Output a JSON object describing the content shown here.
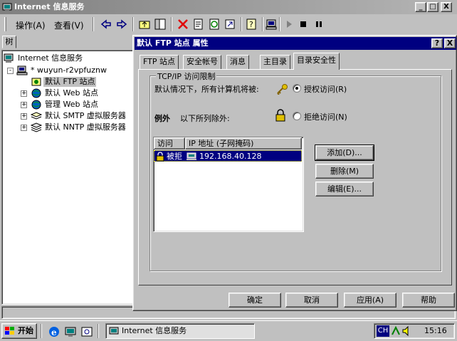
{
  "window": {
    "title": "Internet 信息服务",
    "minimize": "_",
    "maximize": "□",
    "close": "X"
  },
  "menu": {
    "action": "操作(A)",
    "view": "查看(V)"
  },
  "toolbar": {
    "icons": [
      "back-icon",
      "forward-icon",
      "up-folder-icon",
      "show-pane-icon",
      "delete-icon",
      "properties-icon",
      "refresh-icon",
      "export-icon",
      "help-icon",
      "computer-icon",
      "play-icon",
      "stop-icon",
      "pause-icon"
    ]
  },
  "tree": {
    "tab_label": "树",
    "root": "Internet 信息服务",
    "server": "* wuyun-r2vpfuznw",
    "sites": [
      {
        "label": "默认 FTP 站点",
        "expander": "",
        "selected": true
      },
      {
        "label": "默认 Web 站点",
        "expander": "+"
      },
      {
        "label": "管理 Web 站点",
        "expander": "+"
      },
      {
        "label": "默认 SMTP 虚拟服务器",
        "expander": "+"
      },
      {
        "label": "默认 NNTP 虚拟服务器",
        "expander": "+"
      }
    ],
    "root_expander": "-"
  },
  "dialog": {
    "title": "默认 FTP 站点 属性",
    "help_btn": "?",
    "close_btn": "X",
    "tabs": [
      "FTP 站点",
      "安全帐号",
      "消息",
      "主目录",
      "目录安全性"
    ],
    "active_tab": 4,
    "group_title": "TCP/IP 访问限制",
    "default_text": "默认情况下，所有计算机将被:",
    "grant_label": "授权访问(R)",
    "except_label": "例外",
    "except_text": "以下所列除外:",
    "deny_label": "拒绝访问(N)",
    "list": {
      "col_access": "访问",
      "col_ip": "IP 地址 (子网掩码)",
      "rows": [
        {
          "access": "被拒",
          "ip": "192.168.40.128"
        }
      ]
    },
    "buttons": {
      "add": "添加(D)...",
      "remove": "删除(M)",
      "edit": "编辑(E)..."
    },
    "footer": {
      "ok": "确定",
      "cancel": "取消",
      "apply": "应用(A)",
      "help": "帮助"
    }
  },
  "taskbar": {
    "start": "开始",
    "task_item": "Internet 信息服务",
    "lang": "CH",
    "clock": "15:16"
  },
  "colors": {
    "titlebar_active": "#000080",
    "titlebar_inactive": "#808080",
    "face": "#c0c0c0"
  }
}
